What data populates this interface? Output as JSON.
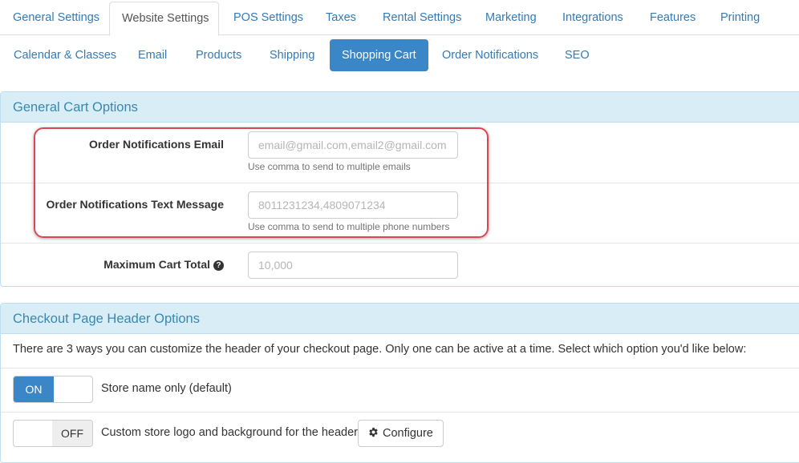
{
  "top_tabs": [
    {
      "label": "General Settings"
    },
    {
      "label": "Website Settings"
    },
    {
      "label": "POS Settings"
    },
    {
      "label": "Taxes"
    },
    {
      "label": "Rental Settings"
    },
    {
      "label": "Marketing"
    },
    {
      "label": "Integrations"
    },
    {
      "label": "Features"
    },
    {
      "label": "Printing"
    }
  ],
  "active_top_tab": "Website Settings",
  "sub_tabs": [
    {
      "label": "Calendar & Classes"
    },
    {
      "label": "Email"
    },
    {
      "label": "Products"
    },
    {
      "label": "Shipping"
    },
    {
      "label": "Shopping Cart"
    },
    {
      "label": "Order Notifications"
    },
    {
      "label": "SEO"
    }
  ],
  "active_sub_tab": "Shopping Cart",
  "general_cart": {
    "heading": "General Cart Options",
    "notif_email": {
      "label": "Order Notifications Email",
      "placeholder": "email@gmail.com,email2@gmail.com",
      "help": "Use comma to send to multiple emails"
    },
    "notif_sms": {
      "label": "Order Notifications Text Message",
      "placeholder": "8011231234,4809071234",
      "help": "Use comma to send to multiple phone numbers"
    },
    "max_total": {
      "label": "Maximum Cart Total",
      "help_icon": "?",
      "placeholder": "10,000"
    }
  },
  "checkout_header": {
    "heading": "Checkout Page Header Options",
    "intro": "There are 3 ways you can customize the header of your checkout page. Only one can be active at a time. Select which option you'd like below:",
    "option1": {
      "state": "ON",
      "label": "Store name only (default)"
    },
    "option2": {
      "state": "OFF",
      "label": "Custom store logo and background for the header",
      "button": "Configure"
    }
  },
  "colors": {
    "accent": "#3a86c6",
    "panel_heading_bg": "#d9edf7",
    "panel_heading_text": "#3a87ad",
    "highlight": "#e0454f"
  }
}
